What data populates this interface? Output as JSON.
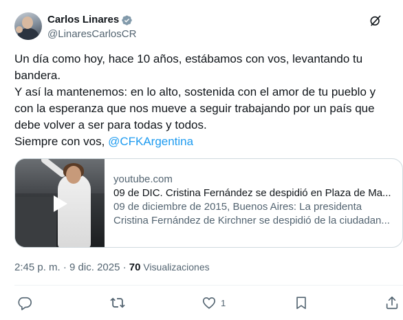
{
  "author": {
    "display_name": "Carlos Linares",
    "handle": "@LinaresCarlosCR",
    "verified_icon": "verified-badge-icon",
    "avatar_icon": "avatar"
  },
  "header_icons": {
    "grok": "grok-icon",
    "more": "more-icon"
  },
  "tweet": {
    "line1": "Un día como hoy, hace 10 años, estábamos con vos, levantando tu",
    "line2": "bandera.",
    "line3": "Y así la mantenemos: en lo alto, sostenida con el amor de tu pueblo y",
    "line4": "con la esperanza que nos mueve a seguir trabajando por un país que",
    "line5": "debe volver a ser para todas y todos.",
    "line6_prefix": "Siempre con vos, ",
    "mention": "@CFKArgentina"
  },
  "card": {
    "domain": "youtube.com",
    "title": "09 de DIC. Cristina Fernández se despidió en Plaza de Ma...",
    "desc1": "09 de diciembre de 2015, Buenos Aires: La presidenta",
    "desc2": "Cristina Fernández de Kirchner se despidió de la ciudadan...",
    "play_icon": "play-icon"
  },
  "meta": {
    "time": "2:45 p. m.",
    "separator": " · ",
    "date": "9 dic. 2025",
    "views_count": "70",
    "views_label": " Visualizaciones"
  },
  "actions": {
    "reply_icon": "reply-icon",
    "retweet_icon": "retweet-icon",
    "like_icon": "like-icon",
    "like_count": "1",
    "bookmark_icon": "bookmark-icon",
    "share_icon": "share-icon"
  },
  "colors": {
    "accent": "#1d9bf0",
    "text": "#0f1419",
    "secondary": "#536471",
    "border": "#cfd9de"
  }
}
